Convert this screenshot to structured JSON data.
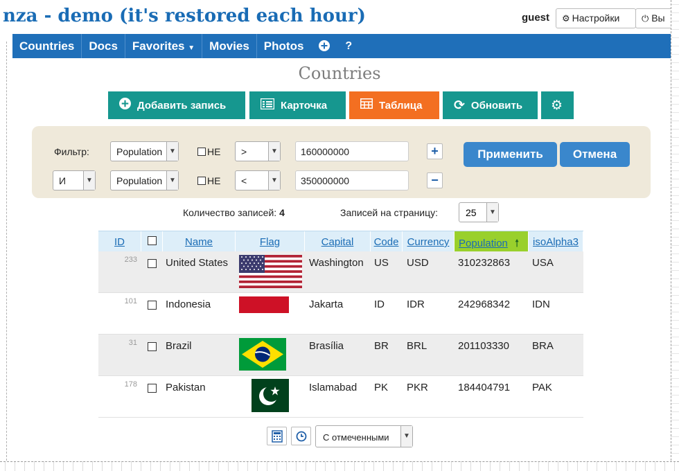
{
  "header": {
    "title": "nza - demo (it's restored each hour)",
    "user": "guest",
    "settings_label": "Настройки",
    "logout_label": "Вы"
  },
  "nav": {
    "items": [
      {
        "label": "Countries"
      },
      {
        "label": "Docs"
      },
      {
        "label": "Favorites"
      },
      {
        "label": "Movies"
      },
      {
        "label": "Photos"
      }
    ],
    "plus_icon": "plus-circle-icon",
    "help_label": "?"
  },
  "page": {
    "title": "Countries"
  },
  "toolbar": {
    "add_label": "Добавить запись",
    "card_label": "Карточка",
    "table_label": "Таблица",
    "refresh_label": "Обновить",
    "colors": {
      "teal": "#16978f",
      "active": "#f36f21"
    }
  },
  "filter": {
    "label": "Фильтр:",
    "rows": [
      {
        "field": "Population",
        "not_label": "НЕ",
        "operator": ">",
        "value": "160000000"
      },
      {
        "logic": "И",
        "field": "Population",
        "not_label": "НЕ",
        "operator": "<",
        "value": "350000000"
      }
    ],
    "apply_label": "Применить",
    "cancel_label": "Отмена"
  },
  "summary": {
    "count_label": "Количество записей:",
    "count": "4",
    "per_page_label": "Записей на страницу:",
    "per_page": "25"
  },
  "table": {
    "columns": [
      "ID",
      "Name",
      "Flag",
      "Capital",
      "Code",
      "Currency",
      "Population",
      "isoAlpha3"
    ],
    "sorted_column": "Population",
    "sort_direction": "ascending",
    "rows": [
      {
        "id": "233",
        "name": "United States",
        "flag": "us-flag",
        "capital": "Washington",
        "code": "US",
        "currency": "USD",
        "population": "310232863",
        "iso3": "USA"
      },
      {
        "id": "101",
        "name": "Indonesia",
        "flag": "id-flag",
        "capital": "Jakarta",
        "code": "ID",
        "currency": "IDR",
        "population": "242968342",
        "iso3": "IDN"
      },
      {
        "id": "31",
        "name": "Brazil",
        "flag": "br-flag",
        "capital": "Brasília",
        "code": "BR",
        "currency": "BRL",
        "population": "201103330",
        "iso3": "BRA"
      },
      {
        "id": "178",
        "name": "Pakistan",
        "flag": "pk-flag",
        "capital": "Islamabad",
        "code": "PK",
        "currency": "PKR",
        "population": "184404791",
        "iso3": "PAK"
      }
    ]
  },
  "footer": {
    "marked_select": "С отмеченными"
  }
}
